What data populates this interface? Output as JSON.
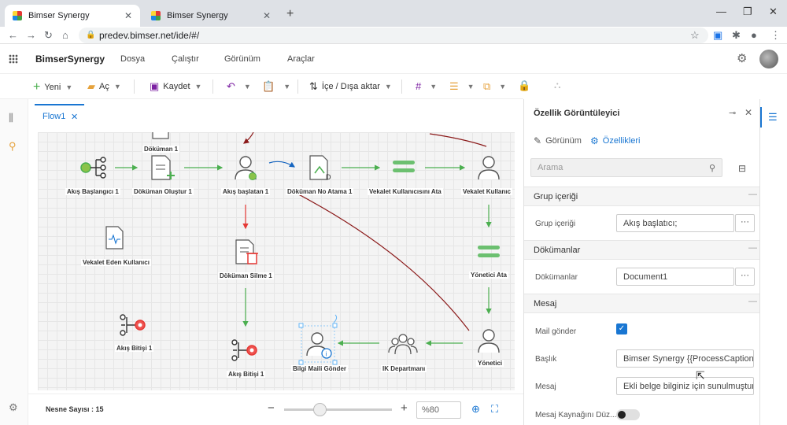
{
  "browser": {
    "tabs": [
      {
        "title": "Bimser Synergy"
      },
      {
        "title": "Bimser Synergy"
      }
    ],
    "url": "predev.bimser.net/ide/#/"
  },
  "app": {
    "brand": "BimserSynergy",
    "menu": [
      "Dosya",
      "Çalıştır",
      "Görünüm",
      "Araçlar"
    ]
  },
  "toolbar": {
    "new_label": "Yeni",
    "open_label": "Aç",
    "save_label": "Kaydet",
    "import_export_label": "İçe / Dışa aktar"
  },
  "editor": {
    "tab_label": "Flow1",
    "nodes": {
      "dokuman1": "Döküman 1",
      "akis_baslangici": "Akış Başlangıcı 1",
      "dokuman_olustur": "Döküman Oluştur 1",
      "akis_baslatan": "Akış başlatan 1",
      "dokuman_no_atama": "Döküman No Atama 1",
      "vekalet_kullanicisini_ata": "Vekalet Kullanıcısını Ata",
      "vekalet_kullanici": "Vekalet Kullanıc",
      "vekalet_eden": "Vekalet Eden Kullanıcı",
      "dokuman_silme": "Döküman Silme 1",
      "yonetici_ata": "Yönetici Ata",
      "akis_bitisi_left": "Akış Bitişi 1",
      "akis_bitisi_center": "Akış Bitişi 1",
      "bilgi_maili": "Bilgi Maili Gönder",
      "ik_departmani": "IK Departmanı",
      "yonetici": "Yönetici"
    }
  },
  "bottom": {
    "object_count": "Nesne Sayısı : 15",
    "zoom": "%80"
  },
  "panel": {
    "title": "Özellik Görüntüleyici",
    "tabs": {
      "view": "Görünüm",
      "properties": "Özellikleri"
    },
    "search_placeholder": "Arama",
    "sections": {
      "group_content": "Grup içeriği",
      "documents": "Dökümanlar",
      "message": "Mesaj"
    },
    "fields": {
      "group_content_label": "Grup içeriği",
      "group_content_value": "Akış başlatıcı;",
      "documents_label": "Dökümanlar",
      "documents_value": "Document1",
      "send_mail_label": "Mail gönder",
      "subject_label": "Başlık",
      "subject_value": "Bimser Synergy {{ProcessCaption}} i",
      "message_label": "Mesaj",
      "message_value": "Ekli belge bilginiz için sunulmuştur",
      "message_source_label": "Mesaj Kaynağını Düz..."
    }
  },
  "colors": {
    "accent": "#1976d2",
    "flow_green": "#4caf50",
    "flow_red": "#e53935",
    "connector_dark_red": "#8b1a1a"
  }
}
